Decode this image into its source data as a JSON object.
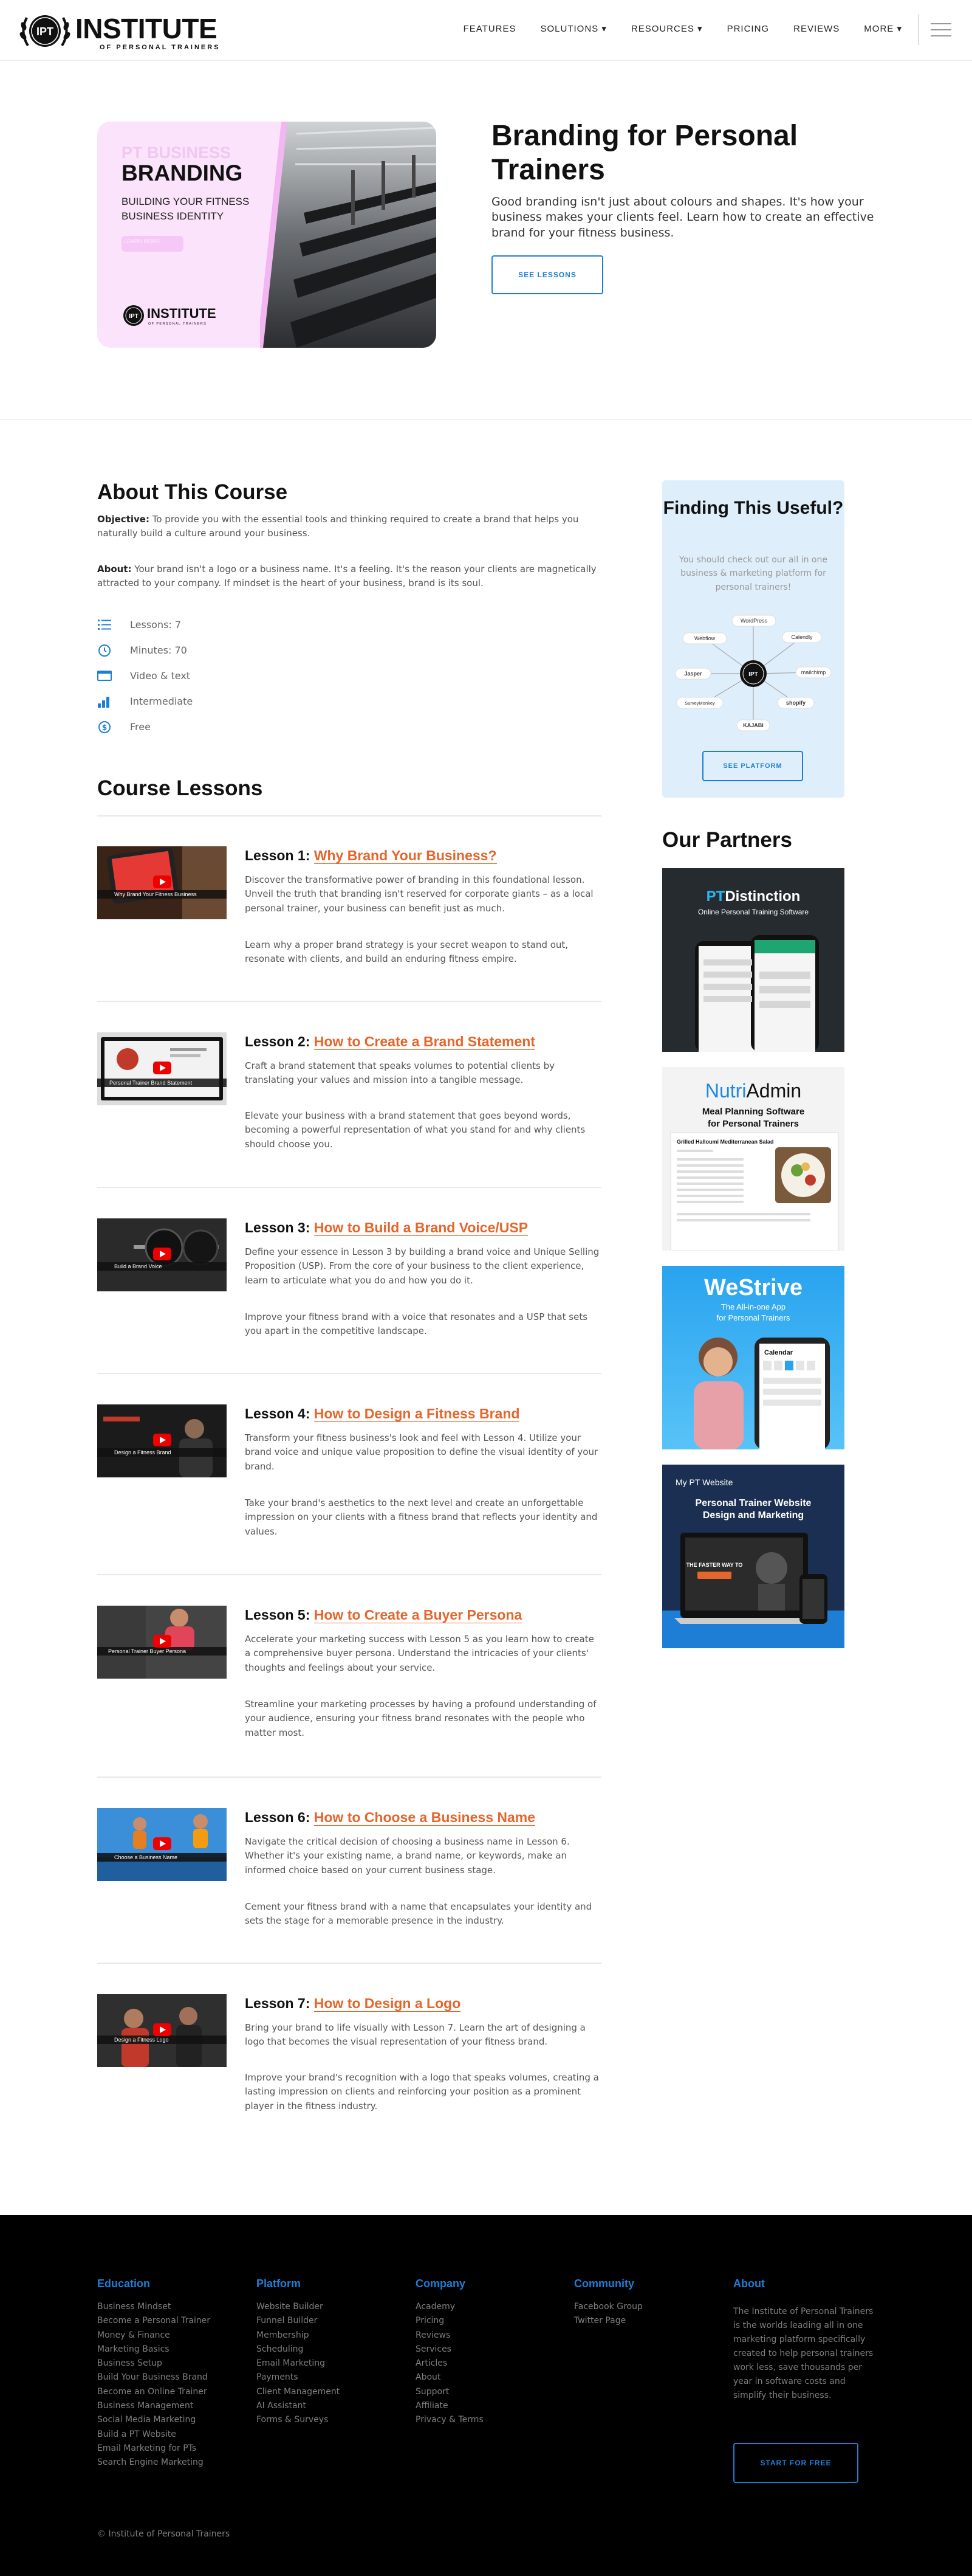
{
  "header": {
    "logo_text": "INSTITUTE",
    "logo_sub": "OF PERSONAL TRAINERS",
    "logo_badge": "IPT",
    "nav": [
      "FEATURES",
      "SOLUTIONS ▾",
      "RESOURCES ▾",
      "PRICING",
      "REVIEWS",
      "MORE ▾"
    ]
  },
  "hero": {
    "image": {
      "faint": "PT BUSINESS",
      "big": "BRANDING",
      "small": "BUILDING YOUR FITNESS BUSINESS IDENTITY",
      "pill": "LEARN MORE"
    },
    "title": "Branding for Personal Trainers",
    "description": "Good branding isn't just about colours and shapes. It's how your business makes your clients feel. Learn how to create an effective brand for your fitness business.",
    "button": "SEE LESSONS"
  },
  "about": {
    "heading": "About This Course",
    "objective_label": "Objective:",
    "objective": "To provide you with the essential tools and thinking required to create a brand that helps you naturally build a culture around your business.",
    "about_label": "About:",
    "about": "Your brand isn't a logo or a business name. It's a feeling. It's the reason your clients are magnetically attracted to your company. If mindset is the heart of your business, brand is its soul.",
    "meta": [
      {
        "icon": "list-icon",
        "text": "Lessons: 7"
      },
      {
        "icon": "clock-icon",
        "text": "Minutes: 70"
      },
      {
        "icon": "screen-icon",
        "text": "Video & text"
      },
      {
        "icon": "bar-chart-icon",
        "text": "Intermediate"
      },
      {
        "icon": "dollar-icon",
        "text": "Free"
      }
    ]
  },
  "lessons_heading": "Course Lessons",
  "lessons": [
    {
      "num": "Lesson 1:",
      "title": "Why Brand Your Business?",
      "thumb": "Why Brand Your Fitness Business",
      "p1": "Discover the transformative power of branding in this foundational lesson. Unveil the truth that branding isn't reserved for corporate giants – as a local personal trainer, your business can benefit just as much.",
      "p2": "Learn why a proper brand strategy is your secret weapon to stand out, resonate with clients, and build an enduring fitness empire."
    },
    {
      "num": "Lesson 2:",
      "title": "How to Create a Brand Statement",
      "thumb": "Personal Trainer Brand Statement",
      "p1": "Craft a brand statement that speaks volumes to potential clients by translating your values and mission into a tangible message.",
      "p2": "Elevate your business with a brand statement that goes beyond words, becoming a powerful representation of what you stand for and why clients should choose you."
    },
    {
      "num": "Lesson 3:",
      "title": "How to Build a Brand Voice/USP",
      "thumb": "Build a Brand Voice",
      "p1": "Define your essence in Lesson 3 by building a brand voice and Unique Selling Proposition (USP). From the core of your business to the client experience, learn to articulate what you do and how you do it.",
      "p2": "Improve your fitness brand with a voice that resonates and a USP that sets you apart in the competitive landscape."
    },
    {
      "num": "Lesson 4:",
      "title": "How to Design a Fitness Brand",
      "thumb": "Design a Fitness Brand",
      "p1": "Transform your fitness business's look and feel with Lesson 4. Utilize your brand voice and unique value proposition to define the visual identity of your brand.",
      "p2": "Take your brand's aesthetics to the next level and create an unforgettable impression on your clients with a fitness brand that reflects your identity and values."
    },
    {
      "num": "Lesson 5:",
      "title": "How to Create a Buyer Persona",
      "thumb": "Personal Trainer Buyer Persona",
      "p1": "Accelerate your marketing success with Lesson 5 as you learn how to create a comprehensive buyer persona. Understand the intricacies of your clients' thoughts and feelings about your service.",
      "p2": "Streamline your marketing processes by having a profound understanding of your audience, ensuring your fitness brand resonates with the people who matter most."
    },
    {
      "num": "Lesson 6:",
      "title": "How to Choose a Business Name",
      "thumb": "Choose a Business Name",
      "p1": "Navigate the critical decision of choosing a business name in Lesson 6. Whether it's your existing name, a brand name, or keywords, make an informed choice based on your current business stage.",
      "p2": "Cement your fitness brand with a name that encapsulates your identity and sets the stage for a memorable presence in the industry."
    },
    {
      "num": "Lesson 7:",
      "title": "How to Design a Logo",
      "thumb": "Design a Fitness Logo",
      "p1": "Bring your brand to life visually with Lesson 7. Learn the art of designing a logo that becomes the visual representation of your fitness brand.",
      "p2": "Improve your brand's recognition with a logo that speaks volumes, creating a lasting impression on clients and reinforcing your position as a prominent player in the fitness industry."
    }
  ],
  "sidebar": {
    "promo_title": "Finding This Useful?",
    "promo_text": "You should check out our all in one business & marketing platform for personal trainers!",
    "promo_logos": [
      "WordPress",
      "Calendly",
      "mailchimp",
      "shopify",
      "KAJABI",
      "SurveyMonkey",
      "Jasper",
      "Webflow"
    ],
    "promo_button": "SEE PLATFORM",
    "partners_heading": "Our Partners",
    "ad1": {
      "brand_a": "PT",
      "brand_b": "Distinction",
      "sub": "Online Personal Training Software"
    },
    "ad2": {
      "brand_a": "Nutri",
      "brand_b": "Admin",
      "sub1": "Meal Planning Software",
      "sub2": "for Personal Trainers",
      "recipe": "Grilled Halloumi Mediterranean Salad"
    },
    "ad3": {
      "brand": "WeStrive",
      "sub1": "The All-in-one App",
      "sub2": "for Personal Trainers",
      "cal": "Calendar"
    },
    "ad4": {
      "top": "My PT Website",
      "sub1": "Personal Trainer Website",
      "sub2": "Design and Marketing",
      "screen": "THE FASTER WAY TO"
    }
  },
  "footer": {
    "columns": [
      {
        "heading": "Education",
        "links": [
          "Business Mindset",
          "Become a Personal Trainer",
          "Money & Finance",
          "Marketing Basics",
          "Business Setup",
          "Build Your Business Brand",
          "Become an Online Trainer",
          "Business Management",
          "Social Media Marketing",
          "Build a PT Website",
          "Email Marketing for PTs",
          "Search Engine Marketing"
        ]
      },
      {
        "heading": "Platform",
        "links": [
          "Website Builder",
          "Funnel Builder",
          "Membership",
          "Scheduling",
          "Email Marketing",
          "Payments",
          "Client Management",
          "AI Assistant",
          "Forms & Surveys"
        ]
      },
      {
        "heading": "Company",
        "links": [
          "Academy",
          "Pricing",
          "Reviews",
          "Services",
          "Articles",
          "About",
          "Support",
          "Affiliate",
          "Privacy & Terms"
        ]
      },
      {
        "heading": "Community",
        "links": [
          "Facebook Group",
          "Twitter Page"
        ]
      }
    ],
    "about_heading": "About",
    "about_text": "The Institute of Personal Trainers is the worlds leading all in one marketing platform specifically created to help personal trainers work less, save thousands per year in software costs and simplify their business.",
    "button": "START FOR FREE",
    "copyright": "© Institute of Personal Trainers"
  },
  "colors": {
    "accent_blue": "#1e7ed6",
    "lesson_orange": "#e5652b",
    "footer_bg": "#000000",
    "promo_bg": "#dfeefb"
  }
}
